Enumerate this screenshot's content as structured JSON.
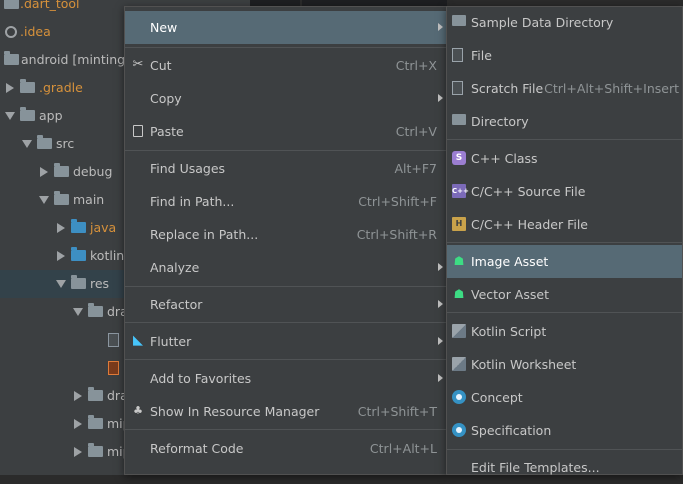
{
  "tree": {
    "items": [
      {
        "label": ".dart_tool",
        "style": "orange"
      },
      {
        "label": ".idea",
        "style": "orange"
      },
      {
        "label": "android [minting_r",
        "style": "normal"
      },
      {
        "label": ".gradle",
        "style": "orange"
      },
      {
        "label": "app",
        "style": "normal"
      },
      {
        "label": "src",
        "style": "normal"
      },
      {
        "label": "debug",
        "style": "normal"
      },
      {
        "label": "main",
        "style": "normal"
      },
      {
        "label": "java",
        "style": "orange"
      },
      {
        "label": "kotlin",
        "style": "normal"
      },
      {
        "label": "res",
        "style": "normal"
      },
      {
        "label": "dra",
        "style": "normal"
      },
      {
        "label": "dra",
        "style": "normal"
      },
      {
        "label": "mip",
        "style": "normal"
      },
      {
        "label": "mip",
        "style": "normal"
      }
    ]
  },
  "context_menu": {
    "new": {
      "label": "New"
    },
    "cut": {
      "label": "Cut",
      "shortcut": "Ctrl+X"
    },
    "copy": {
      "label": "Copy"
    },
    "paste": {
      "label": "Paste",
      "shortcut": "Ctrl+V"
    },
    "find_usages": {
      "label": "Find Usages",
      "shortcut": "Alt+F7"
    },
    "find_in_path": {
      "label": "Find in Path...",
      "shortcut": "Ctrl+Shift+F"
    },
    "replace_in_path": {
      "label": "Replace in Path...",
      "shortcut": "Ctrl+Shift+R"
    },
    "analyze": {
      "label": "Analyze"
    },
    "refactor": {
      "label": "Refactor"
    },
    "flutter": {
      "label": "Flutter"
    },
    "add_to_favorites": {
      "label": "Add to Favorites"
    },
    "show_in_resource_manager": {
      "label": "Show In Resource Manager",
      "shortcut": "Ctrl+Shift+T"
    },
    "reformat_code": {
      "label": "Reformat Code",
      "shortcut": "Ctrl+Alt+L"
    }
  },
  "submenu_new": {
    "sample_data_directory": {
      "label": "Sample Data Directory"
    },
    "file": {
      "label": "File"
    },
    "scratch_file": {
      "label": "Scratch File",
      "shortcut": "Ctrl+Alt+Shift+Insert"
    },
    "directory": {
      "label": "Directory"
    },
    "cpp_class": {
      "label": "C++ Class"
    },
    "cpp_source_file": {
      "label": "C/C++ Source File"
    },
    "cpp_header_file": {
      "label": "C/C++ Header File"
    },
    "image_asset": {
      "label": "Image Asset"
    },
    "vector_asset": {
      "label": "Vector Asset"
    },
    "kotlin_script": {
      "label": "Kotlin Script"
    },
    "kotlin_worksheet": {
      "label": "Kotlin Worksheet"
    },
    "concept": {
      "label": "Concept"
    },
    "specification": {
      "label": "Specification"
    },
    "edit_file_templates": {
      "label": "Edit File Templates..."
    }
  },
  "colors": {
    "highlight": "#566a75",
    "menu_bg": "#3c3f41",
    "tree_orange": "#d6913b",
    "android_green": "#3ddc84"
  }
}
